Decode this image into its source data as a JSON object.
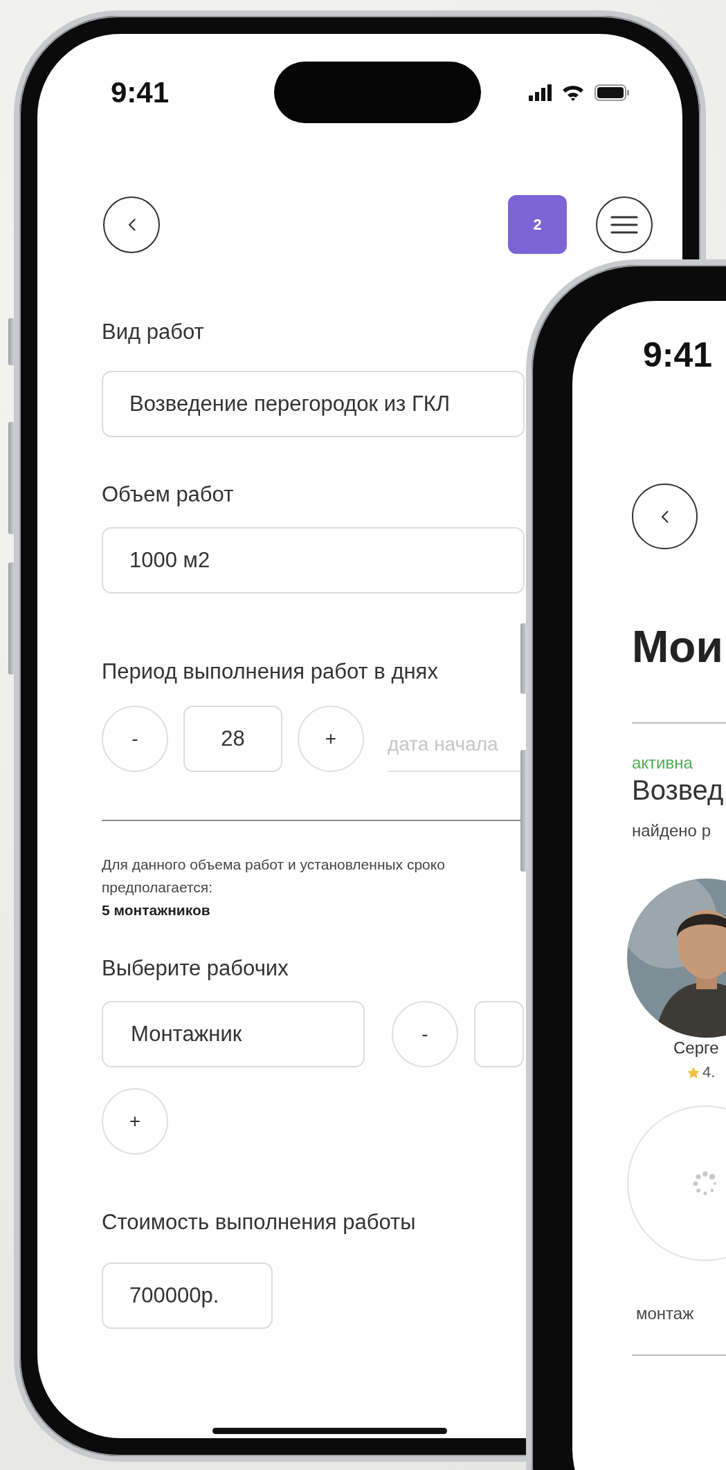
{
  "form_screen": {
    "status_bar": {
      "time": "9:41"
    },
    "header": {
      "badge": "2"
    },
    "work_type": {
      "label": "Вид работ",
      "value": "Возведение перегородок из ГКЛ"
    },
    "volume": {
      "label": "Объем работ",
      "value": "1000 м2"
    },
    "period": {
      "label": "Период выполнения работ в днях",
      "minus": "-",
      "value": "28",
      "plus": "+",
      "start_date": {
        "placeholder": "дата начала"
      }
    },
    "estimate": {
      "lines": [
        "Для данного объема работ и установленных сроко",
        "предполагается:"
      ],
      "result": "5 монтажников"
    },
    "workers": {
      "label": "Выберите рабочих",
      "rows": [
        {
          "role": "Монтажник",
          "minus": "-"
        }
      ],
      "add": "+"
    },
    "cost": {
      "label": "Стоимость выполнения работы",
      "value": "700000р."
    }
  },
  "orders_screen": {
    "status_bar": {
      "time": "9:41"
    },
    "title": "Мои",
    "order": {
      "status": "активна",
      "name": "Возвед",
      "found": "найдено р",
      "workers": [
        {
          "kind": "profile",
          "name": "Серге",
          "rating": "4."
        },
        {
          "kind": "loading",
          "role": "монтаж"
        }
      ]
    }
  }
}
